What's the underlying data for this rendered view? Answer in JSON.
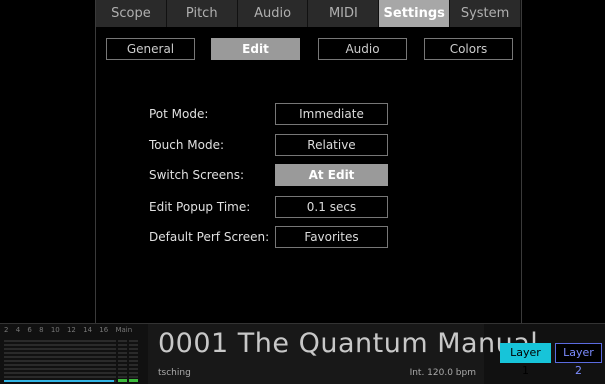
{
  "top_tabs": [
    "Scope",
    "Pitch",
    "Audio",
    "MIDI",
    "Settings",
    "System"
  ],
  "active_top_tab": "Settings",
  "sub_tabs": [
    "General",
    "Edit",
    "Audio",
    "Colors"
  ],
  "active_sub_tab": "Edit",
  "settings": [
    {
      "label": "Pot Mode:",
      "value": "Immediate",
      "active": false
    },
    {
      "label": "Touch Mode:",
      "value": "Relative",
      "active": false
    },
    {
      "label": "Switch Screens:",
      "value": "At Edit",
      "active": true
    },
    {
      "label": "Edit Popup Time:",
      "value": "0.1 secs",
      "active": false
    },
    {
      "label": "Default Perf Screen:",
      "value": "Favorites",
      "active": false
    }
  ],
  "meters": {
    "labels": [
      "2",
      "4",
      "6",
      "8",
      "10",
      "12",
      "14",
      "16",
      "Main"
    ]
  },
  "patch": {
    "name": "0001 The Quantum Manual",
    "author": "tsching",
    "tempo": "Int. 120.0 bpm"
  },
  "layers": {
    "layer1": "Layer 1",
    "layer2": "Layer 2",
    "active": "Layer 1"
  },
  "colors": {
    "accent": "#17c4d9",
    "active_tab": "#a7a7a7",
    "layer2": "#7c8cff"
  }
}
